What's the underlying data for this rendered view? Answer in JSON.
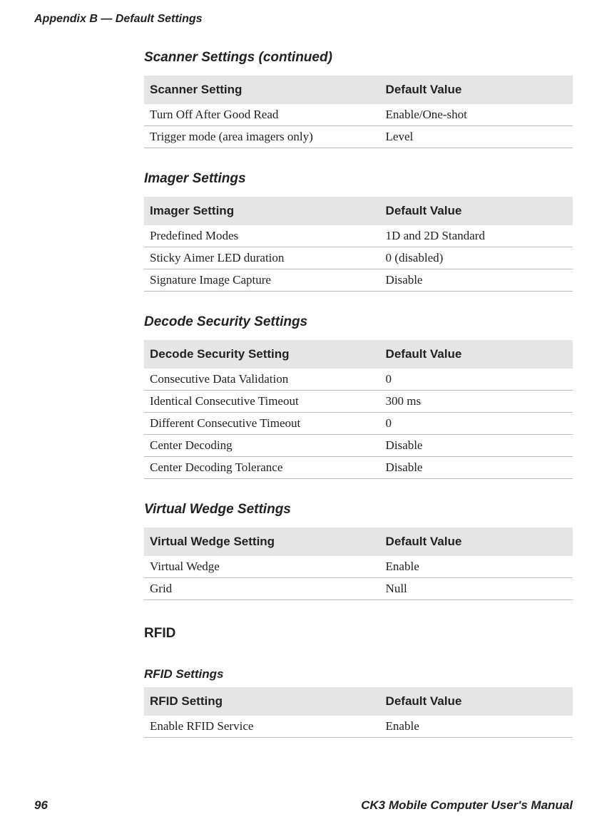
{
  "header": {
    "appendix": "Appendix B — Default Settings"
  },
  "sections": {
    "scanner": {
      "title": "Scanner Settings (continued)",
      "col1": "Scanner Setting",
      "col2": "Default Value",
      "rows": [
        {
          "setting": "Turn Off After Good Read",
          "value": "Enable/One-shot"
        },
        {
          "setting": "Trigger mode (area imagers only)",
          "value": "Level"
        }
      ]
    },
    "imager": {
      "title": "Imager Settings",
      "col1": "Imager Setting",
      "col2": "Default Value",
      "rows": [
        {
          "setting": "Predefined Modes",
          "value": "1D and 2D Standard"
        },
        {
          "setting": "Sticky Aimer LED duration",
          "value": "0 (disabled)"
        },
        {
          "setting": "Signature Image Capture",
          "value": "Disable"
        }
      ]
    },
    "decode": {
      "title": "Decode Security Settings",
      "col1": "Decode Security Setting",
      "col2": "Default Value",
      "rows": [
        {
          "setting": "Consecutive Data Validation",
          "value": "0"
        },
        {
          "setting": "Identical Consecutive Timeout",
          "value": "300 ms"
        },
        {
          "setting": "Different Consecutive Timeout",
          "value": "0"
        },
        {
          "setting": "Center Decoding",
          "value": "Disable"
        },
        {
          "setting": "Center Decoding Tolerance",
          "value": "Disable"
        }
      ]
    },
    "wedge": {
      "title": "Virtual Wedge Settings",
      "col1": "Virtual Wedge Setting",
      "col2": "Default Value",
      "rows": [
        {
          "setting": "Virtual Wedge",
          "value": "Enable"
        },
        {
          "setting": "Grid",
          "value": "Null"
        }
      ]
    },
    "rfid_category": {
      "title": "RFID"
    },
    "rfid": {
      "title": "RFID Settings",
      "col1": "RFID Setting",
      "col2": "Default Value",
      "rows": [
        {
          "setting": "Enable RFID Service",
          "value": "Enable"
        }
      ]
    }
  },
  "footer": {
    "page": "96",
    "manual": "CK3 Mobile Computer User's Manual"
  }
}
